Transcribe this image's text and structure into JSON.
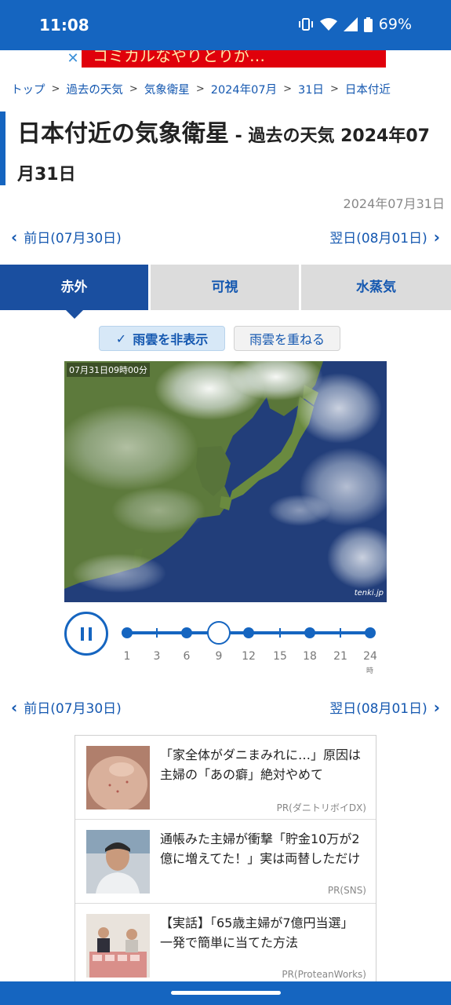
{
  "status": {
    "time": "11:08",
    "battery": "69%"
  },
  "ad_banner": {
    "close_label": "✕",
    "text": "コミカルなやりとりが…"
  },
  "breadcrumb": [
    "トップ",
    "過去の天気",
    "気象衛星",
    "2024年07月",
    "31日",
    "日本付近"
  ],
  "breadcrumb_sep": ">",
  "title": {
    "main": "日本付近の気象衛星",
    "sub": " - 過去の天気 2024年07月31日"
  },
  "date_label": "2024年07月31日",
  "day_nav": {
    "prev_label": "前日(07月30日)",
    "next_label": "翌日(08月01日)",
    "prev_icon": "‹",
    "next_icon": "›"
  },
  "tabs": [
    {
      "label": "赤外",
      "active": true
    },
    {
      "label": "可視",
      "active": false
    },
    {
      "label": "水蒸気",
      "active": false
    }
  ],
  "cloud_toggle": {
    "hide_label": "雨雲を非表示",
    "overlay_label": "雨雲を重ねる",
    "check_icon": "✓"
  },
  "satellite": {
    "timestamp": "07月31日09時00分",
    "logo": "tenki.jp"
  },
  "timeline": {
    "labels": [
      "1",
      "3",
      "6",
      "9",
      "12",
      "15",
      "18",
      "21",
      "24"
    ],
    "unit": "時",
    "selected": "9",
    "dot_hours": [
      "1",
      "6",
      "12",
      "18",
      "24"
    ],
    "tick_hours": [
      "3",
      "15",
      "21"
    ]
  },
  "ads": [
    {
      "title": "「家全体がダニまみれに…」原因は主婦の「あの癖」絶対やめて",
      "source": "PR(ダニトリボイDX)"
    },
    {
      "title": "通帳みた主婦が衝撃「貯金10万が2億に増えてた！」実は両替しただけ",
      "source": "PR(SNS)"
    },
    {
      "title": "【実話】「65歳主婦が7億円当選」一発で簡単に当てた方法",
      "source": "PR(ProteanWorks)"
    }
  ],
  "colors": {
    "brand": "#1565c0",
    "tab_active": "#1a4fa0",
    "link": "#1558b0"
  }
}
